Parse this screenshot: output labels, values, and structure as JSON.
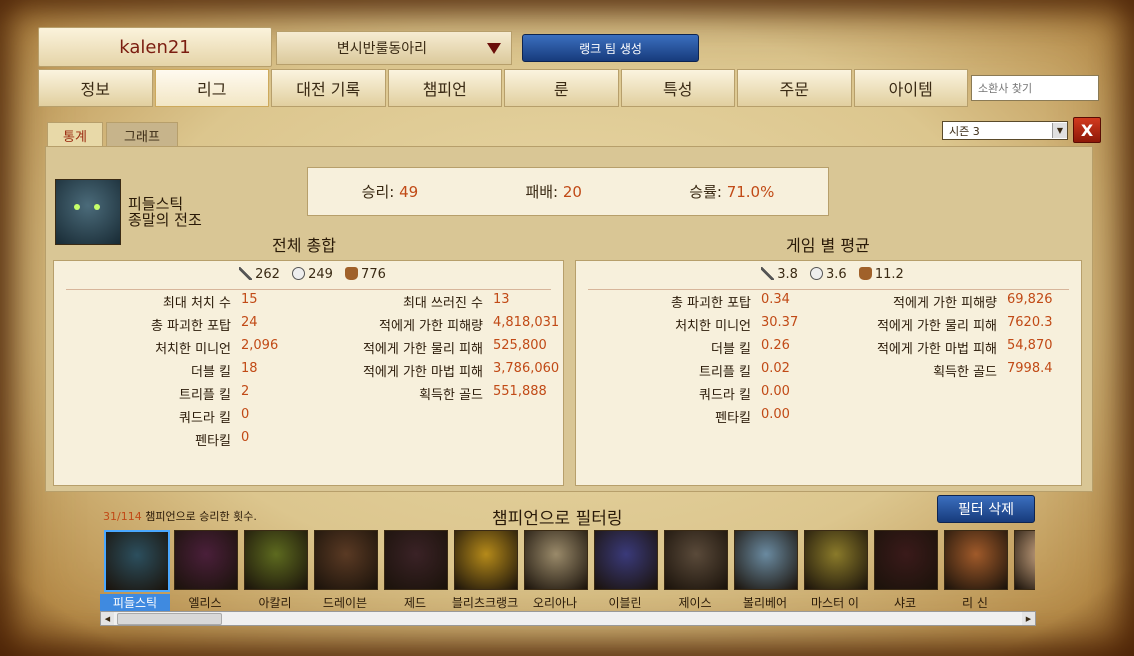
{
  "header": {
    "username": "kalen21",
    "club": "변시반룰동아리",
    "rank_team_button": "랭크 팀 생성"
  },
  "nav": {
    "tabs": [
      "정보",
      "리그",
      "대전 기록",
      "챔피언",
      "룬",
      "특성",
      "주문",
      "아이템"
    ],
    "active": 1,
    "search_placeholder": "소환사 찾기"
  },
  "subtabs": {
    "stats": "통계",
    "graph": "그래프"
  },
  "season": {
    "selected": "시즌 3"
  },
  "champion": {
    "name": "피들스틱",
    "title": "종말의 전조"
  },
  "summary": {
    "wins_label": "승리:",
    "wins": "49",
    "losses_label": "패배:",
    "losses": "20",
    "winrate_label": "승률:",
    "winrate": "71.0%"
  },
  "totals": {
    "title": "전체 총합",
    "kda": {
      "kills": "262",
      "deaths": "249",
      "assists": "776"
    },
    "left": [
      {
        "label": "최대 처치 수",
        "value": "15"
      },
      {
        "label": "총 파괴한 포탑",
        "value": "24"
      },
      {
        "label": "처치한 미니언",
        "value": "2,096"
      },
      {
        "label": "더블 킬",
        "value": "18"
      },
      {
        "label": "트리플 킬",
        "value": "2"
      },
      {
        "label": "쿼드라 킬",
        "value": "0"
      },
      {
        "label": "펜타킬",
        "value": "0"
      }
    ],
    "right": [
      {
        "label": "최대 쓰러진 수",
        "value": "13"
      },
      {
        "label": "적에게 가한 피해량",
        "value": "4,818,031"
      },
      {
        "label": "적에게 가한 물리 피해",
        "value": "525,800"
      },
      {
        "label": "적에게 가한 마법 피해",
        "value": "3,786,060"
      },
      {
        "label": "획득한 골드",
        "value": "551,888"
      }
    ]
  },
  "averages": {
    "title": "게임 별 평균",
    "kda": {
      "kills": "3.8",
      "deaths": "3.6",
      "assists": "11.2"
    },
    "left": [
      {
        "label": "총 파괴한 포탑",
        "value": "0.34"
      },
      {
        "label": "처치한 미니언",
        "value": "30.37"
      },
      {
        "label": "더블 킬",
        "value": "0.26"
      },
      {
        "label": "트리플 킬",
        "value": "0.02"
      },
      {
        "label": "쿼드라 킬",
        "value": "0.00"
      },
      {
        "label": "펜타킬",
        "value": "0.00"
      }
    ],
    "right": [
      {
        "label": "적에게 가한 피해량",
        "value": "69,826"
      },
      {
        "label": "적에게 가한 물리 피해",
        "value": "7620.3"
      },
      {
        "label": "적에게 가한 마법 피해",
        "value": "54,870"
      },
      {
        "label": "획득한 골드",
        "value": "7998.4"
      }
    ]
  },
  "filter": {
    "count": "31/114",
    "count_text": "챔피언으로 승리한 횟수.",
    "title": "챔피언으로 필터링",
    "clear_button": "필터 삭제",
    "champions": [
      {
        "name": "피들스틱",
        "color": "#2c4f5e",
        "selected": true
      },
      {
        "name": "엘리스",
        "color": "#4a1f3a"
      },
      {
        "name": "아칼리",
        "color": "#5d6a1f"
      },
      {
        "name": "드레이븐",
        "color": "#5a3a24"
      },
      {
        "name": "제드",
        "color": "#3a2226"
      },
      {
        "name": "블리츠크랭크",
        "color": "#b58a1a"
      },
      {
        "name": "오리아나",
        "color": "#9a8a6a"
      },
      {
        "name": "이블린",
        "color": "#3a3a7a"
      },
      {
        "name": "제이스",
        "color": "#5a4a3a"
      },
      {
        "name": "볼리베어",
        "color": "#6a8aa0"
      },
      {
        "name": "마스터 이",
        "color": "#8a7a2a"
      },
      {
        "name": "샤코",
        "color": "#3a1a1a"
      },
      {
        "name": "리 신",
        "color": "#a05a2a"
      },
      {
        "name": "",
        "color": "#d8b08a"
      }
    ]
  }
}
